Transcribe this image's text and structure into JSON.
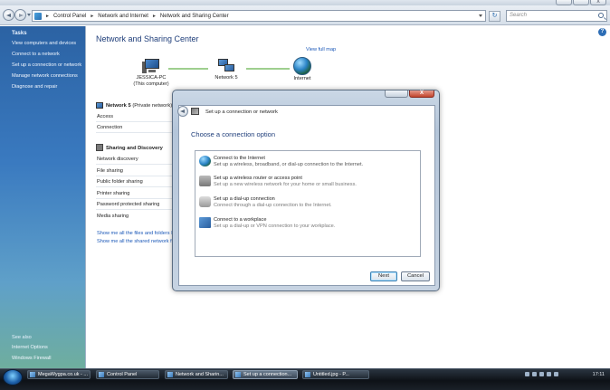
{
  "address_bar": {
    "crumbs": [
      "Control Panel",
      "Network and Internet",
      "Network and Sharing Center"
    ],
    "search_placeholder": "Search"
  },
  "window_buttons": {
    "close": "X"
  },
  "tasks": {
    "heading": "Tasks",
    "items": [
      "View computers and devices",
      "Connect to a network",
      "Set up a connection or network",
      "Manage network connections",
      "Diagnose and repair"
    ],
    "see_also_heading": "See also",
    "see_also": [
      "Internet Options",
      "Windows Firewall"
    ]
  },
  "main": {
    "help": "?",
    "title": "Network and Sharing Center",
    "view_full_map": "View full map",
    "nodes": {
      "computer_name": "JESSICA-PC",
      "computer_sub": "(This computer)",
      "network": "Network 5",
      "internet": "Internet"
    },
    "network_header": "Network 5",
    "network_type": "(Private network)",
    "network_rows": [
      "Access",
      "Connection"
    ],
    "sharing_title": "Sharing and Discovery",
    "sharing_rows": [
      "Network discovery",
      "File sharing",
      "Public folder sharing",
      "Printer sharing",
      "Password protected sharing",
      "Media sharing"
    ],
    "links": [
      "Show me all the files and folders I am sharing",
      "Show me all the shared network folders on this computer"
    ]
  },
  "dialog": {
    "title": "Set up a connection or network",
    "heading": "Choose a connection option",
    "close_label": "X",
    "options": [
      {
        "title": "Connect to the Internet",
        "desc": "Set up a wireless, broadband, or dial-up connection to the Internet.",
        "icon": "globe-icon"
      },
      {
        "title": "Set up a wireless router or access point",
        "desc": "Set up a new wireless network for your home or small business.",
        "icon": "router-icon"
      },
      {
        "title": "Set up a dial-up connection",
        "desc": "Connect through a dial-up connection to the Internet.",
        "icon": "modem-icon"
      },
      {
        "title": "Connect to a workplace",
        "desc": "Set up a dial-up or VPN connection to your workplace.",
        "icon": "workplace-icon"
      }
    ],
    "next_label": "Next",
    "cancel_label": "Cancel"
  },
  "taskbar": {
    "items": [
      "MegaWygpa.co.uk - ...",
      "Control Panel",
      "Network and Sharin...",
      "Set up a connection...",
      "Untitled.jpg - P..."
    ],
    "active_index": 3,
    "clock": "17:11"
  }
}
